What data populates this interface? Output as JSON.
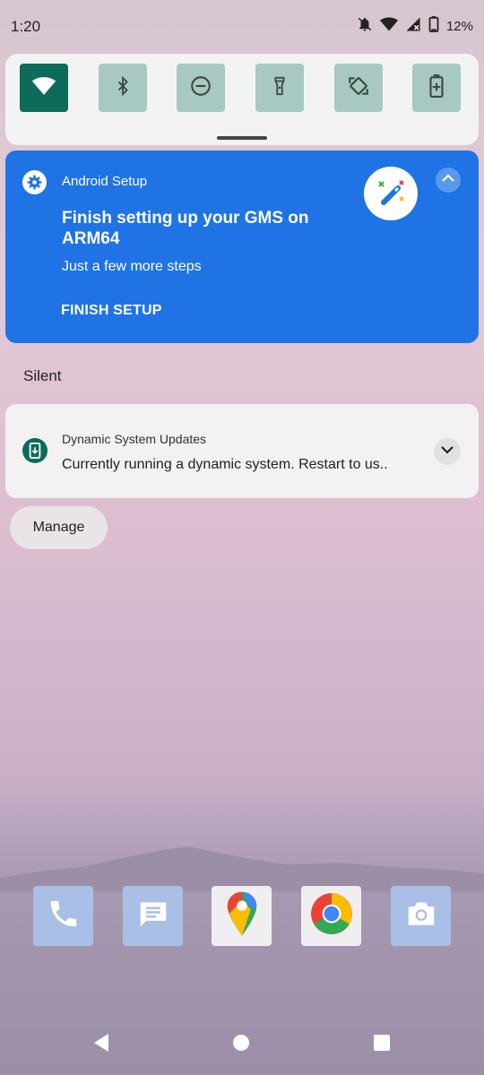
{
  "status_bar": {
    "time": "1:20",
    "battery_percent": "12%",
    "icons": [
      "notifications-off-icon",
      "wifi-icon",
      "signal-icon",
      "battery-icon"
    ]
  },
  "quick_settings": {
    "tiles": [
      {
        "icon": "wifi-icon",
        "active": true
      },
      {
        "icon": "bluetooth-icon",
        "active": false
      },
      {
        "icon": "do-not-disturb-icon",
        "active": false
      },
      {
        "icon": "flashlight-icon",
        "active": false
      },
      {
        "icon": "auto-rotate-icon",
        "active": false
      },
      {
        "icon": "battery-saver-icon",
        "active": false
      }
    ],
    "active_color": "#0d6b5a",
    "inactive_color": "#a8c9c1"
  },
  "setup_notification": {
    "app_name": "Android Setup",
    "title": "Finish setting up your GMS on ARM64",
    "text": "Just a few more steps",
    "action": "FINISH SETUP",
    "background_color": "#1f73e5"
  },
  "silent_section": {
    "header": "Silent"
  },
  "dsu_notification": {
    "app_name": "Dynamic System Updates",
    "text": "Currently running a dynamic system. Restart to us.."
  },
  "manage_button": {
    "label": "Manage"
  },
  "dock": {
    "apps": [
      "phone-icon",
      "messages-icon",
      "maps-icon",
      "chrome-icon",
      "camera-icon"
    ]
  },
  "nav_bar": {
    "buttons": [
      "back",
      "home",
      "recents"
    ]
  }
}
